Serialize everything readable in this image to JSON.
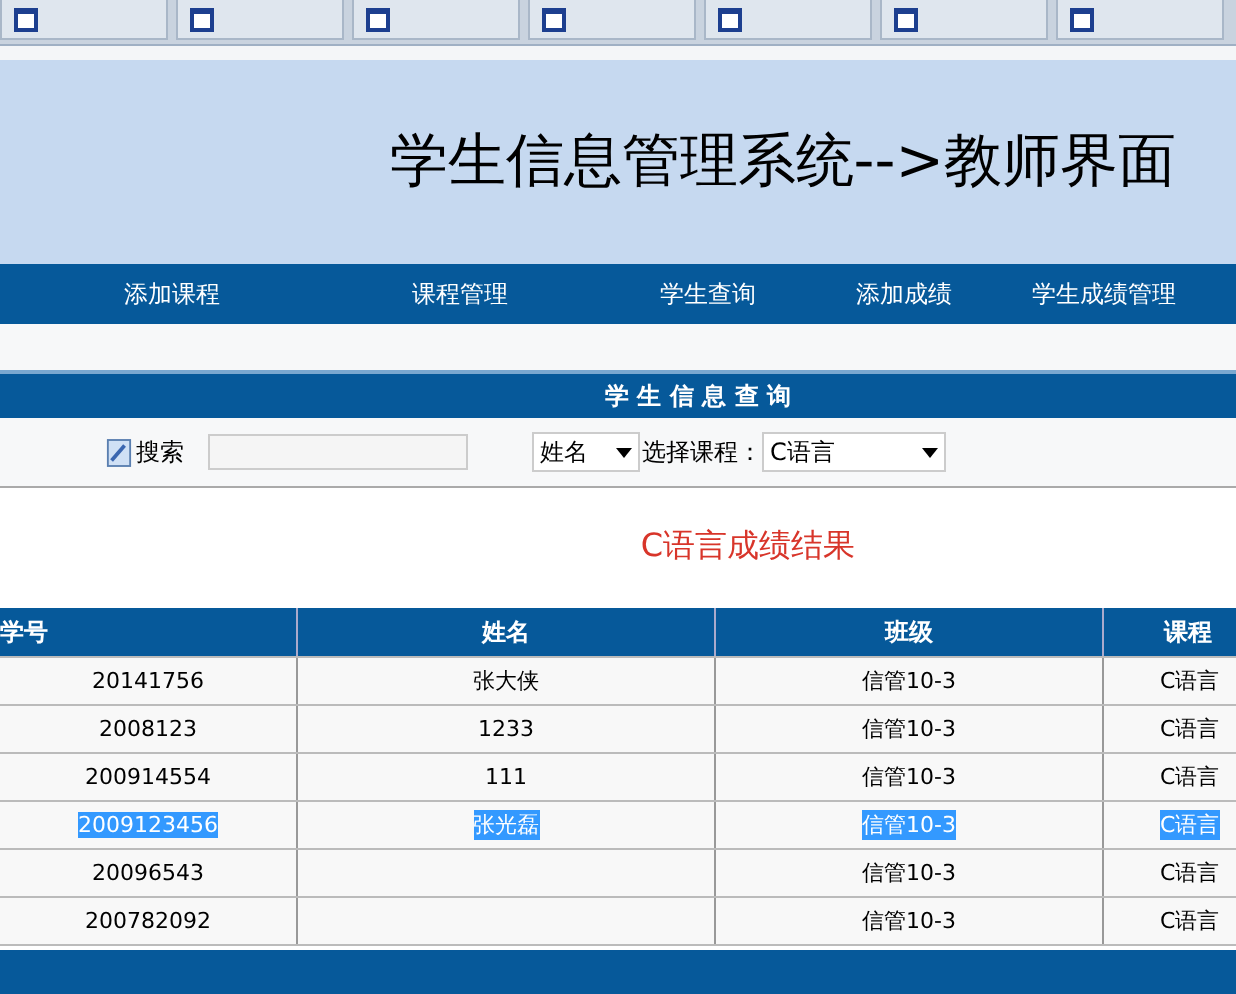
{
  "header": {
    "title": "学生信息管理系统-->教师界面"
  },
  "nav": [
    "添加课程",
    "课程管理",
    "学生查询",
    "添加成绩",
    "学生成绩管理"
  ],
  "panel_title": "学 生 信 息 查 询",
  "search": {
    "label": "搜索",
    "field_select": "姓名",
    "course_label": "选择课程：",
    "course_select": "C语言"
  },
  "result_title": "C语言成绩结果",
  "table": {
    "columns": [
      "学号",
      "姓名",
      "班级",
      "课程"
    ],
    "rows": [
      {
        "cells": [
          "20141756",
          "张大侠",
          "信管10-3",
          "C语言"
        ],
        "selected": false
      },
      {
        "cells": [
          "2008123",
          "1233",
          "信管10-3",
          "C语言"
        ],
        "selected": false
      },
      {
        "cells": [
          "200914554",
          "111",
          "信管10-3",
          "C语言"
        ],
        "selected": false
      },
      {
        "cells": [
          "2009123456",
          "张光磊",
          "信管10-3",
          "C语言"
        ],
        "selected": true
      },
      {
        "cells": [
          "20096543",
          "",
          "信管10-3",
          "C语言"
        ],
        "selected": false
      },
      {
        "cells": [
          "200782092",
          "",
          "信管10-3",
          "C语言"
        ],
        "selected": false
      }
    ]
  }
}
